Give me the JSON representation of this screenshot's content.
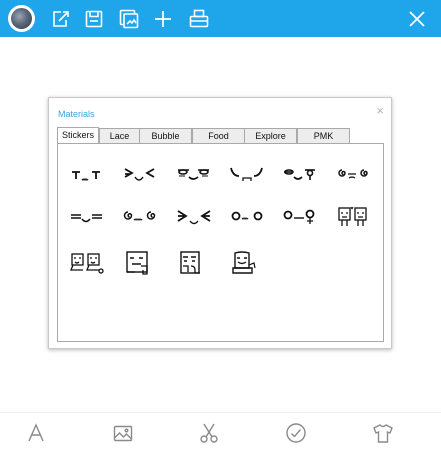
{
  "toolbar": {
    "avatar": "avatar-image",
    "icons": [
      "share-icon",
      "save-icon",
      "gallery-icon",
      "add-icon",
      "print-icon"
    ],
    "close": "close-icon"
  },
  "dialog": {
    "title": "Materials",
    "close_glyph": "×",
    "tabs": [
      "Stickers",
      "Lace",
      "Bubble",
      "Food",
      "Explore",
      "PMK"
    ],
    "active_tab": "Stickers",
    "stickers": [
      "T_T face",
      "squint face",
      "cool face",
      "crying face",
      "sneer face",
      "dizzy face",
      "sleepy face",
      "swirl face",
      "angry face",
      "o_o face",
      "surprised face",
      "two friends",
      "two smilers",
      "hiding character",
      "peeking character",
      "sitting character"
    ]
  },
  "bottom_bar": {
    "icons": [
      "text-icon",
      "image-icon",
      "scissors-icon",
      "check-circle-icon",
      "tshirt-icon"
    ]
  },
  "colors": {
    "topbar": "#1fa5ea",
    "title_text": "#3aa5dd",
    "bottom_icons": "#8a8a8a"
  }
}
